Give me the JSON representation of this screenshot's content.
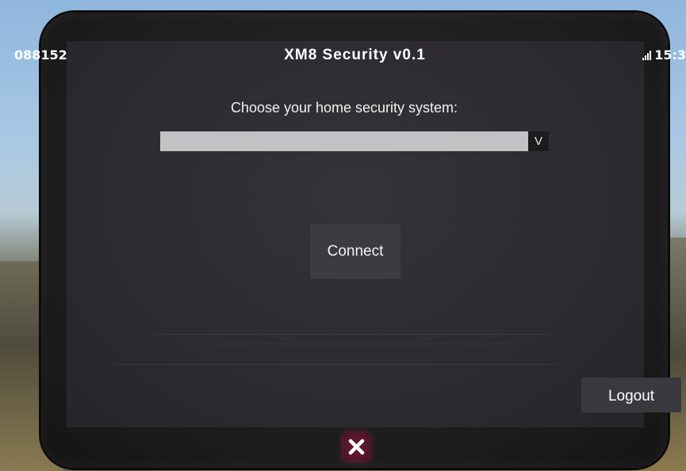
{
  "status_bar": {
    "id_code": "088152",
    "title": "XM8 Security v0.1",
    "time": "15:3"
  },
  "main": {
    "prompt": "Choose your home security system:",
    "dropdown": {
      "selected": "",
      "arrow_glyph": "V"
    },
    "connect_label": "Connect",
    "logout_label": "Logout"
  },
  "colors": {
    "screen": "#2c2b30",
    "dropdown_field": "#c2c1c4",
    "close_button": "#5a1629"
  }
}
